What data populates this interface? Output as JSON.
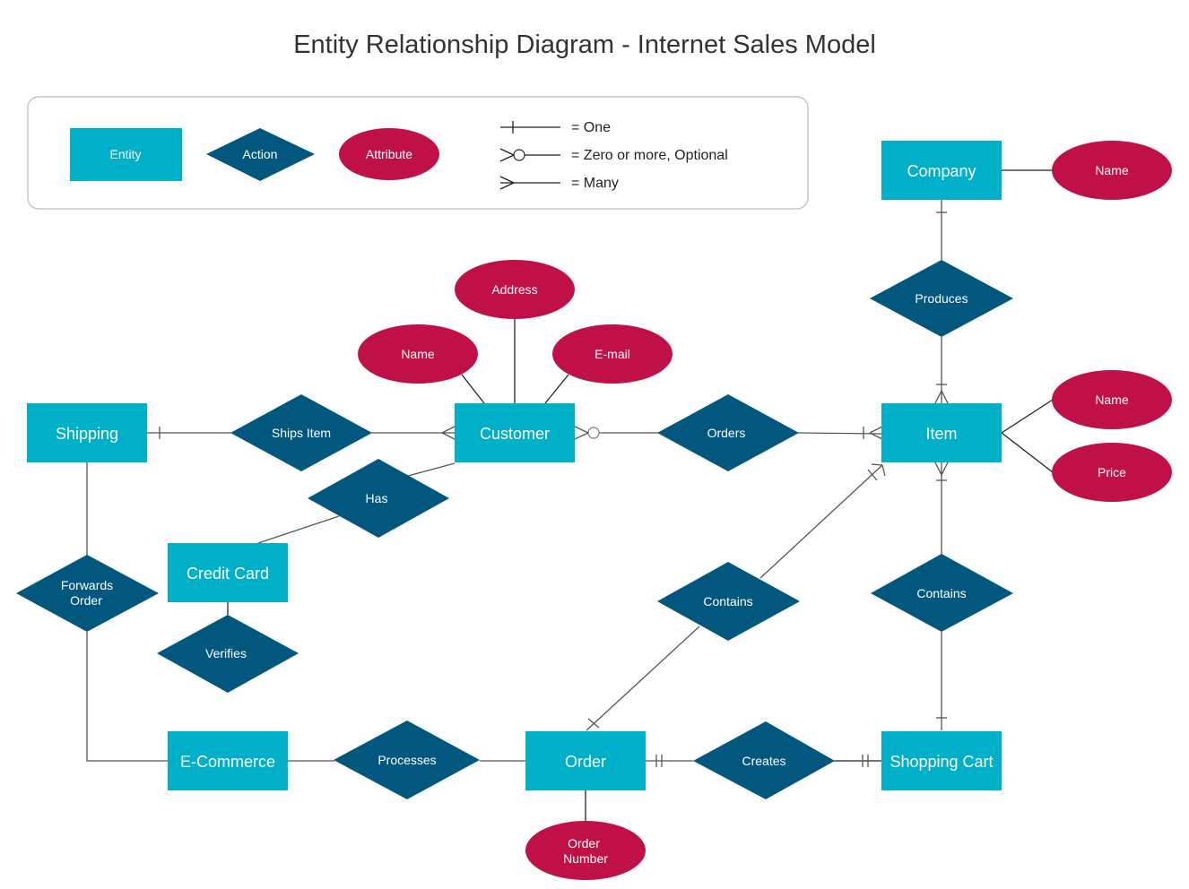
{
  "title": "Entity Relationship Diagram - Internet Sales Model",
  "colors": {
    "entity": "#00b0c8",
    "action": "#01577e",
    "attribute": "#c01048",
    "line": "#555555",
    "legend_border": "#bbbbbb"
  },
  "legend": {
    "entity": "Entity",
    "action": "Action",
    "attribute": "Attribute",
    "one": "= One",
    "zero_or_more": "= Zero or more, Optional",
    "many": "= Many"
  },
  "entities": {
    "company": "Company",
    "item": "Item",
    "customer": "Customer",
    "shipping": "Shipping",
    "credit_card": "Credit Card",
    "ecommerce": "E-Commerce",
    "order": "Order",
    "shopping_cart": "Shopping Cart"
  },
  "actions": {
    "produces": "Produces",
    "ships_item": "Ships Item",
    "orders": "Orders",
    "has": "Has",
    "forwards_order": [
      "Forwards",
      "Order"
    ],
    "verifies": "Verifies",
    "contains_order_item": "Contains",
    "contains_cart_item": "Contains",
    "processes": "Processes",
    "creates": "Creates"
  },
  "attributes": {
    "company_name": "Name",
    "item_name": "Name",
    "item_price": "Price",
    "customer_address": "Address",
    "customer_name": "Name",
    "customer_email": "E-mail",
    "order_number": [
      "Order",
      "Number"
    ]
  }
}
